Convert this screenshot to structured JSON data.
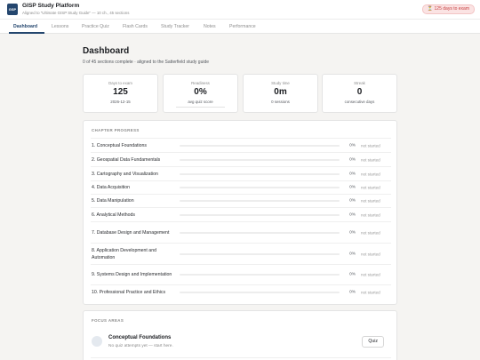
{
  "app": {
    "logo_text": "GSP",
    "title": "GISP Study Platform",
    "subtitle": "Aligned to \"Ultimate GISP Study Guide\" — 10 ch., 45 sections",
    "exam_badge": "⏳ 125 days to exam"
  },
  "tabs": [
    {
      "label": "Dashboard",
      "active": true
    },
    {
      "label": "Lessons",
      "active": false
    },
    {
      "label": "Practice Quiz",
      "active": false
    },
    {
      "label": "Flash Cards",
      "active": false
    },
    {
      "label": "Study Tracker",
      "active": false
    },
    {
      "label": "Notes",
      "active": false
    },
    {
      "label": "Performance",
      "active": false
    }
  ],
  "page": {
    "title": "Dashboard",
    "subtitle": "0 of 45 sections complete · aligned to the Satterfield study guide"
  },
  "stats": [
    {
      "label": "Days to exam",
      "value": "125",
      "sub": "2026-12-15"
    },
    {
      "label": "Readiness",
      "value": "0%",
      "sub": "avg quiz score",
      "bar_fraction": 0
    },
    {
      "label": "Study time",
      "value": "0m",
      "sub": "0 sessions"
    },
    {
      "label": "Streak",
      "value": "0",
      "sub": "consecutive days"
    }
  ],
  "chapter_progress": {
    "title": "CHAPTER PROGRESS",
    "chapters": [
      {
        "name": "1. Conceptual Foundations",
        "percent": 0,
        "percent_label": "0%",
        "status": "not started"
      },
      {
        "name": "2. Geospatial Data Fundamentals",
        "percent": 0,
        "percent_label": "0%",
        "status": "not started"
      },
      {
        "name": "3. Cartography and Visualization",
        "percent": 0,
        "percent_label": "0%",
        "status": "not started"
      },
      {
        "name": "4. Data Acquisition",
        "percent": 0,
        "percent_label": "0%",
        "status": "not started"
      },
      {
        "name": "5. Data Manipulation",
        "percent": 0,
        "percent_label": "0%",
        "status": "not started"
      },
      {
        "name": "6. Analytical Methods",
        "percent": 0,
        "percent_label": "0%",
        "status": "not started"
      },
      {
        "name": "7. Database Design and Management",
        "percent": 0,
        "percent_label": "0%",
        "status": "not started"
      },
      {
        "name": "8. Application Development and Automation",
        "percent": 0,
        "percent_label": "0%",
        "status": "not started"
      },
      {
        "name": "9. Systems Design and Implementation",
        "percent": 0,
        "percent_label": "0%",
        "status": "not started"
      },
      {
        "name": "10. Professional Practice and Ethics",
        "percent": 0,
        "percent_label": "0%",
        "status": "not started"
      }
    ]
  },
  "focus_areas": {
    "title": "FOCUS AREAS",
    "items": [
      {
        "name": "Conceptual Foundations",
        "desc": "No quiz attempts yet — start here.",
        "button": "Quiz"
      }
    ]
  },
  "colors": {
    "accent": "#24466e",
    "badge_bg": "#fbe3e3",
    "badge_text": "#c53d3d",
    "page_bg": "#f5f4f2"
  },
  "icons": {
    "logo": "app-logo",
    "exam_badge": "hourglass-icon",
    "focus_item": "circle-avatar-icon"
  }
}
